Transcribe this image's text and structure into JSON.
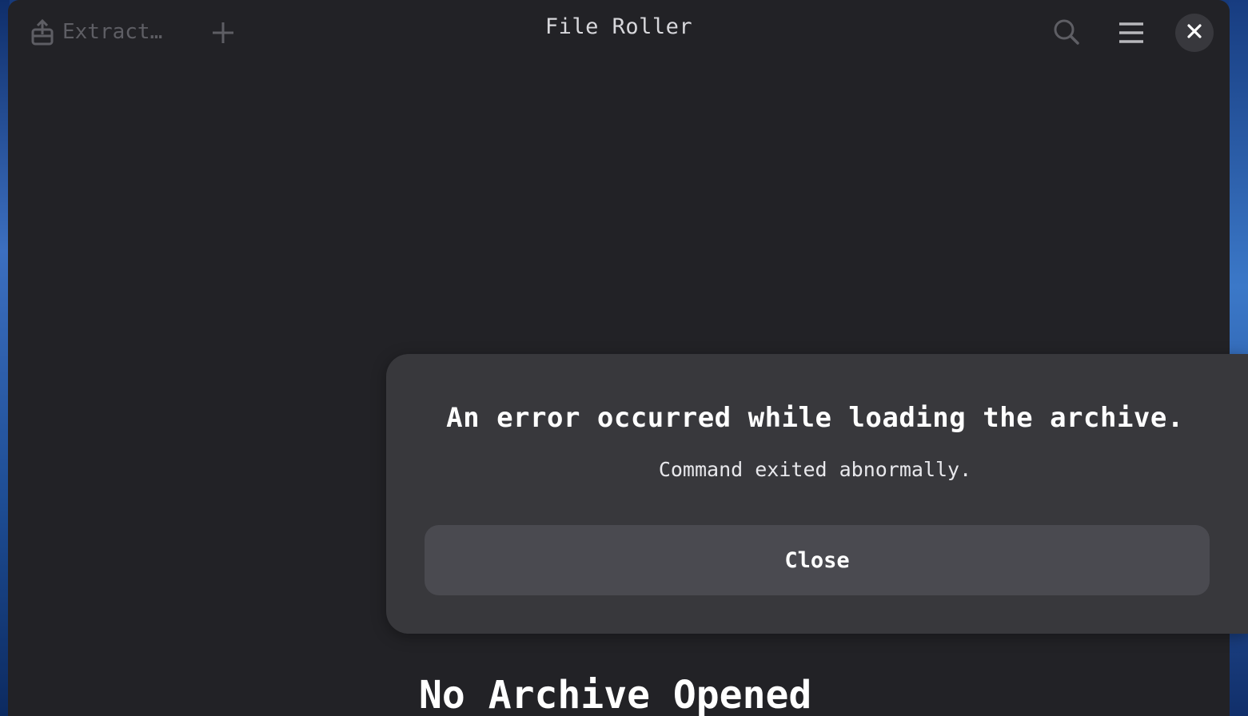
{
  "window": {
    "title": "File Roller"
  },
  "header": {
    "extract_label": "Extract…",
    "extract_icon": "extract-icon",
    "add_icon": "plus-icon",
    "search_icon": "search-icon",
    "menu_icon": "hamburger-menu-icon",
    "close_icon": "close-icon"
  },
  "main": {
    "empty_title": "No Archive Opened"
  },
  "dialog": {
    "heading": "An error occurred while loading the archive.",
    "message": "Command exited abnormally.",
    "close_label": "Close"
  },
  "colors": {
    "window_bg": "#222226",
    "dialog_bg": "#38383c",
    "button_bg": "#4a4a50",
    "text": "#ffffff",
    "disabled_text": "#5e5e64"
  }
}
